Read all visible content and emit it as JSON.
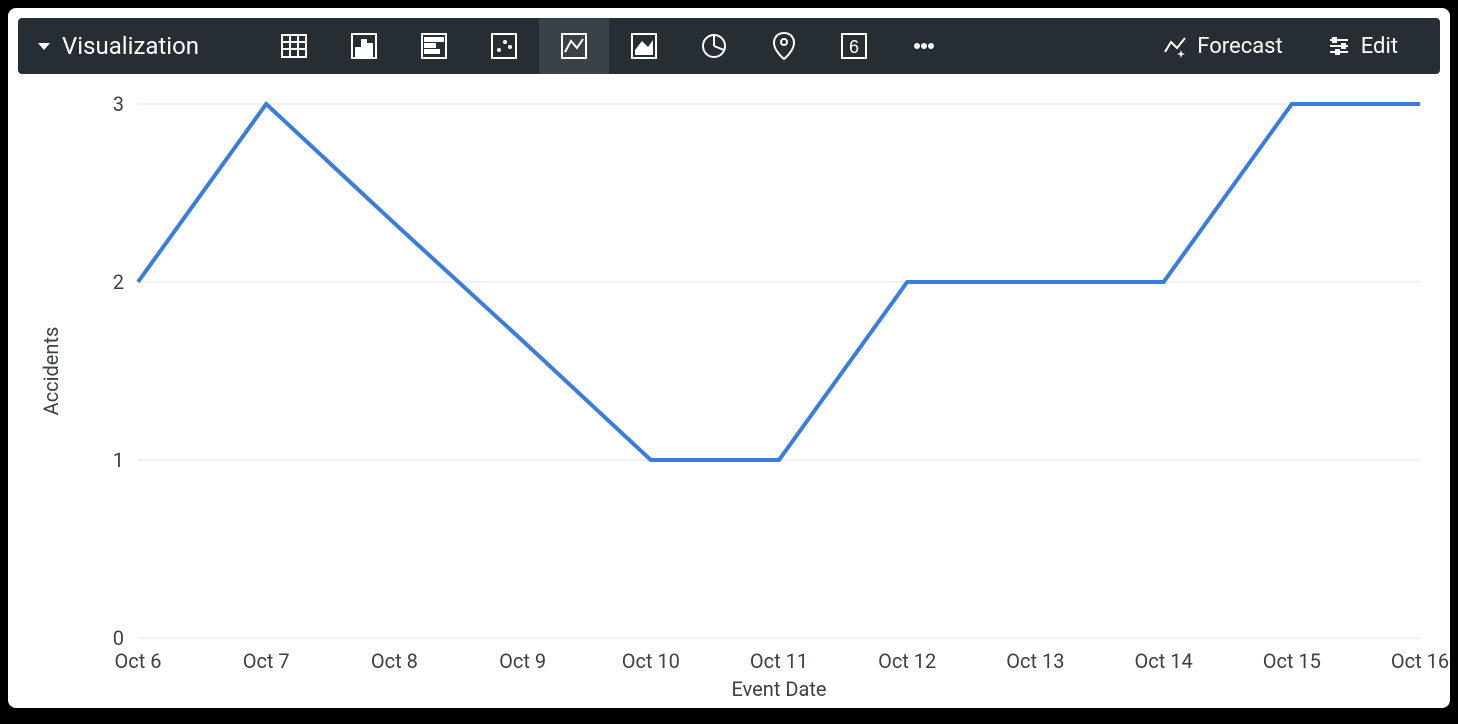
{
  "toolbar": {
    "title": "Visualization",
    "forecast_label": "Forecast",
    "edit_label": "Edit",
    "icons": [
      "table-icon",
      "bar-chart-icon",
      "row-chart-icon",
      "scatter-icon",
      "line-chart-icon",
      "area-chart-icon",
      "pie-icon",
      "map-pin-icon",
      "single-value-icon",
      "more-icon"
    ],
    "active_icon": "line-chart-icon"
  },
  "chart_data": {
    "type": "line",
    "xlabel": "Event Date",
    "ylabel": "Accidents",
    "ylim": [
      0,
      3
    ],
    "yticks": [
      0,
      1,
      2,
      3
    ],
    "categories": [
      "Oct 6",
      "Oct 7",
      "Oct 8",
      "Oct 9",
      "Oct 10",
      "Oct 11",
      "Oct 12",
      "Oct 13",
      "Oct 14",
      "Oct 15",
      "Oct 16"
    ],
    "values": [
      2,
      3,
      2.33,
      1.67,
      1,
      1,
      2,
      2,
      2,
      3,
      3
    ],
    "line_color": "#3b7ddd"
  }
}
